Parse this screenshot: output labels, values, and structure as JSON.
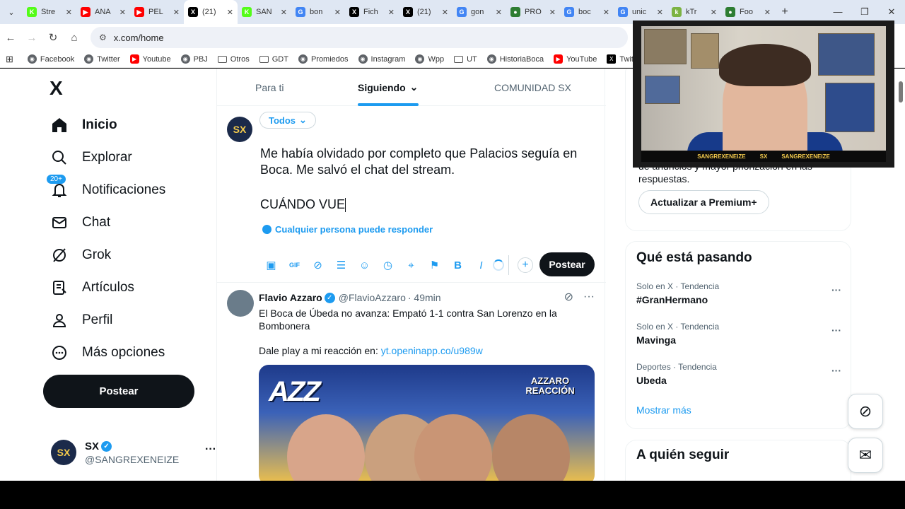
{
  "browser": {
    "tabs": [
      {
        "title": "Stre",
        "color": "#53fc18",
        "glyph": "K"
      },
      {
        "title": "ANA",
        "color": "#ff0000",
        "glyph": "▶"
      },
      {
        "title": "PEL",
        "color": "#ff0000",
        "glyph": "▶"
      },
      {
        "title": "(21)",
        "color": "#000000",
        "glyph": "X",
        "active": true
      },
      {
        "title": "SAN",
        "color": "#53fc18",
        "glyph": "K"
      },
      {
        "title": "bon",
        "color": "#4285f4",
        "glyph": "G"
      },
      {
        "title": "Fich",
        "color": "#000000",
        "glyph": "X"
      },
      {
        "title": "(21)",
        "color": "#000000",
        "glyph": "X"
      },
      {
        "title": "gon",
        "color": "#4285f4",
        "glyph": "G"
      },
      {
        "title": "PRO",
        "color": "#2e7d32",
        "glyph": "●"
      },
      {
        "title": "boc",
        "color": "#4285f4",
        "glyph": "G"
      },
      {
        "title": "unic",
        "color": "#4285f4",
        "glyph": "G"
      },
      {
        "title": "kTr",
        "color": "#7cb342",
        "glyph": "k"
      },
      {
        "title": "Foo",
        "color": "#2e7d32",
        "glyph": "●"
      }
    ],
    "url": "x.com/home",
    "bookmarks": [
      {
        "label": "Facebook",
        "kind": "globe"
      },
      {
        "label": "Twitter",
        "kind": "globe"
      },
      {
        "label": "Youtube",
        "kind": "youtube"
      },
      {
        "label": "PBJ",
        "kind": "globe"
      },
      {
        "label": "Otros",
        "kind": "folder"
      },
      {
        "label": "GDT",
        "kind": "folder"
      },
      {
        "label": "Promiedos",
        "kind": "globe"
      },
      {
        "label": "Instagram",
        "kind": "globe"
      },
      {
        "label": "Wpp",
        "kind": "globe"
      },
      {
        "label": "UT",
        "kind": "folder"
      },
      {
        "label": "HistoriaBoca",
        "kind": "globe"
      },
      {
        "label": "YouTube",
        "kind": "youtube"
      },
      {
        "label": "Twitter",
        "kind": "x"
      }
    ]
  },
  "nav": {
    "logo": "X",
    "items": [
      {
        "label": "Inicio",
        "icon": "home-icon"
      },
      {
        "label": "Explorar",
        "icon": "search-icon"
      },
      {
        "label": "Notificaciones",
        "icon": "bell-icon"
      },
      {
        "label": "Chat",
        "icon": "mail-icon"
      },
      {
        "label": "Grok",
        "icon": "grok-icon"
      },
      {
        "label": "Artículos",
        "icon": "article-icon"
      },
      {
        "label": "Perfil",
        "icon": "person-icon"
      },
      {
        "label": "Más opciones",
        "icon": "more-circle-icon"
      }
    ],
    "notif_badge": "20+",
    "post_label": "Postear",
    "account": {
      "name": "SX",
      "handle": "@SANGREXENEIZE",
      "avatar": "SX"
    }
  },
  "feed": {
    "tabs": [
      "Para ti",
      "Siguiendo",
      "COMUNIDAD SX"
    ],
    "active_tab": "Siguiendo",
    "composer": {
      "audience": "Todos",
      "text_line1": "Me había olvidado por completo que Palacios seguía en Boca. Me salvó el chat del stream.",
      "text_line2": "CUÁNDO VUE",
      "reply_setting": "Cualquier persona puede responder",
      "post_label": "Postear"
    },
    "tweet": {
      "name": "Flavio Azzaro",
      "handle": "@FlavioAzzaro",
      "time": "· 49min",
      "body": "El Boca de Úbeda no avanza: Empató 1-1 contra San Lorenzo en la Bombonera",
      "link_prefix": "Dale play a mi reacción en:",
      "link": "yt.openinapp.co/u989w",
      "media_title": "AZZ",
      "media_tag": "AZZARO REACCIÓN"
    }
  },
  "sidebar": {
    "premium_text": "de anuncios y mayor priorización en las respuestas.",
    "premium_btn": "Actualizar a Premium+",
    "trends_title": "Qué está pasando",
    "trends": [
      {
        "meta": "Solo en X · Tendencia",
        "name": "#GranHermano"
      },
      {
        "meta": "Solo en X · Tendencia",
        "name": "Mavinga"
      },
      {
        "meta": "Deportes · Tendencia",
        "name": "Ubeda"
      }
    ],
    "show_more": "Mostrar más",
    "follow_title": "A quién seguir"
  },
  "webcam": {
    "bar_items": [
      "SANGREXENEIZE",
      "SX",
      "SANGREXENEIZE"
    ]
  }
}
